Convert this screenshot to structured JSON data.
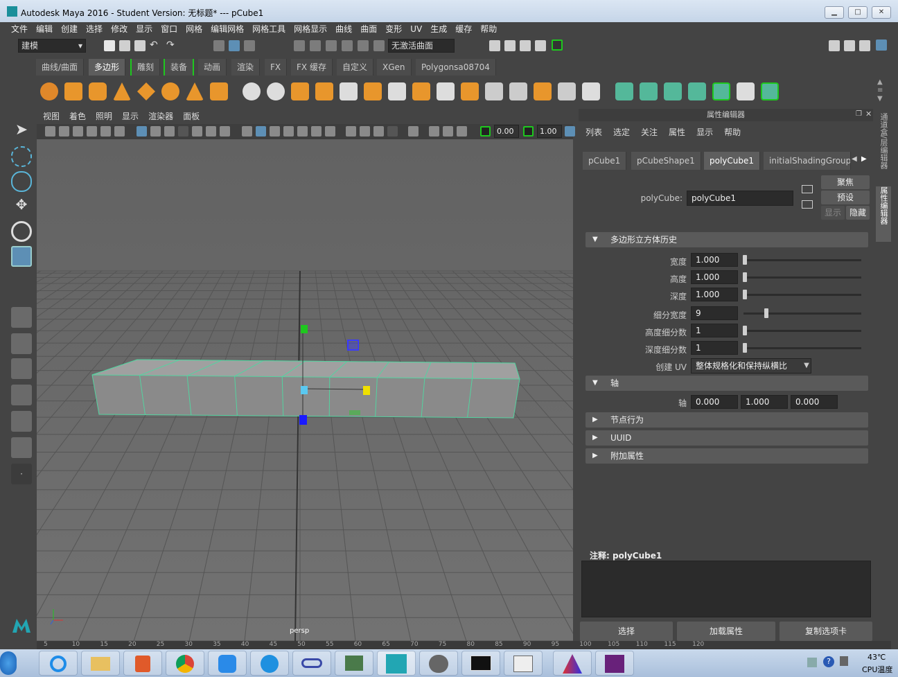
{
  "window": {
    "title": "Autodesk Maya 2016 - Student Version: 无标题*   ---   pCube1"
  },
  "menubar": [
    "文件",
    "编辑",
    "创建",
    "选择",
    "修改",
    "显示",
    "窗口",
    "网格",
    "编辑网格",
    "网格工具",
    "网格显示",
    "曲线",
    "曲面",
    "变形",
    "UV",
    "生成",
    "缓存",
    "帮助"
  ],
  "statusline": {
    "mode": "建模",
    "live_surface": "无激活曲面"
  },
  "shelf_tabs": [
    "曲线/曲面",
    "多边形",
    "雕刻",
    "装备",
    "动画",
    "渲染",
    "FX",
    "FX 缓存",
    "自定义",
    "XGen",
    "Polygonsa08704"
  ],
  "shelf_active": "多边形",
  "viewport": {
    "menu": [
      "视图",
      "着色",
      "照明",
      "显示",
      "渲染器",
      "面板"
    ],
    "near_value": "0.00",
    "far_value": "1.00",
    "camera_label": "persp"
  },
  "attribute_editor": {
    "header": "属性编辑器",
    "menu": [
      "列表",
      "选定",
      "关注",
      "属性",
      "显示",
      "帮助"
    ],
    "tabs": [
      "pCube1",
      "pCubeShape1",
      "polyCube1",
      "initialShadingGroup"
    ],
    "active_tab": "polyCube1",
    "node_label": "polyCube:",
    "node_name": "polyCube1",
    "buttons": {
      "focus": "聚焦",
      "preset": "预设",
      "show": "显示",
      "hide": "隐藏"
    },
    "section_history": "多边形立方体历史",
    "attrs": [
      {
        "label": "宽度",
        "value": "1.000",
        "slider": 0.0
      },
      {
        "label": "高度",
        "value": "1.000",
        "slider": 0.0
      },
      {
        "label": "深度",
        "value": "1.000",
        "slider": 0.0
      }
    ],
    "subdiv": [
      {
        "label": "细分宽度",
        "value": "9",
        "slider": 0.18
      },
      {
        "label": "高度细分数",
        "value": "1",
        "slider": 0.0
      },
      {
        "label": "深度细分数",
        "value": "1",
        "slider": 0.0
      }
    ],
    "create_uv_label": "创建 UV",
    "create_uv_value": "整体规格化和保持纵横比",
    "section_axis": "轴",
    "axis_label": "轴",
    "axis_values": [
      "0.000",
      "1.000",
      "0.000"
    ],
    "section_node_behavior": "节点行为",
    "section_uuid": "UUID",
    "section_extra": "附加属性",
    "notes_label": "注释:",
    "notes_node": "polyCube1",
    "bottom_buttons": [
      "选择",
      "加载属性",
      "复制选项卡"
    ]
  },
  "side_tabs": [
    "通道盒/层编辑器",
    "属性编辑器"
  ],
  "timeline_ticks": [
    "5",
    "10",
    "15",
    "20",
    "25",
    "30",
    "35",
    "40",
    "45",
    "50",
    "55",
    "60",
    "65",
    "70",
    "75",
    "80",
    "85",
    "90",
    "95",
    "100",
    "105",
    "110",
    "115",
    "120"
  ],
  "taskbar": {
    "temperature": "43℃",
    "cpu_label": "CPU温度"
  },
  "colors": {
    "accent_green": "#54d3a0",
    "active_blue": "#5d8fb5",
    "handle_green": "#1ec81e",
    "handle_blue": "#1a1aff",
    "handle_yellow": "#f0e000",
    "handle_cyan": "#5ac8f0"
  }
}
